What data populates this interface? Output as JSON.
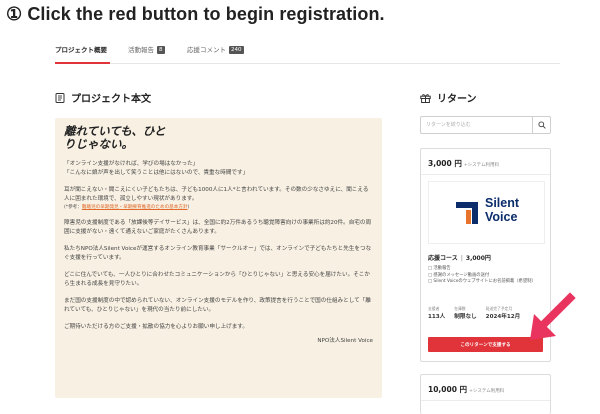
{
  "instruction": "① Click the red button to begin registration.",
  "tabs": [
    {
      "label": "プロジェクト概要"
    },
    {
      "label": "活動報告",
      "badge": "8"
    },
    {
      "label": "応援コメント",
      "badge": "240"
    }
  ],
  "story": {
    "section_title": "プロジェクト本文",
    "heading": "離れていても、ひとりじゃない。",
    "quote1": "「オンライン支援がなければ、学びの場はなかった」",
    "quote2": "「こんなに娘が声を出して笑うことは他にはないので、貴重な時間です」",
    "p1": "耳が聞こえない・聞こえにくい子どもたちは、子ども1000人に1人*と言われています。その数の少なさゆえに、聞こえる人に囲まれた環境で、孤立しやすい現状があります。",
    "note_prefix": "(*参考：",
    "note_link": "難聴児の早期発見・早期療育推進のための基本方針",
    "note_suffix": ")",
    "p2": "障害児の支援制度である「放課後等デイサービス」は、全国に約2万件あるうち聴覚障害向けの事業所は約20件。自宅の周囲に支援がない・遠くて通えないご家庭がたくさんあります。",
    "p3": "私たちNPO法人Silent Voiceが運営するオンライン教育事業「サークルオー」では、オンラインで子どもたちと先生をつなぐ支援を行っています。",
    "p4": "どこに住んでいても、一人ひとりに合わせたコミュニケーションから「ひとりじゃない」と思える安心を届けたい。そこから生まれる成長を見守りたい。",
    "p5": "まだ国の支援制度の中で認められていない、オンライン支援のモデルを作り、政策提言を行うことで国の仕組みとして「離れていても、ひとりじゃない」を現代の当たり前にしたい。",
    "p6": "ご期待いただける方のご支援・拡散の協力を心よりお願い申し上げます。",
    "signature": "NPO法人Silent Voice"
  },
  "returns": {
    "section_title": "リターン",
    "search_placeholder": "リターンを絞り込む",
    "card1": {
      "price": "3,000 円",
      "fee_note": "+システム利用料",
      "logo_line1": "Silent",
      "logo_line2": "Voice",
      "course_name": "応援コース",
      "course_price": "3,000円",
      "features": [
        "□ 活動報告",
        "□ 感謝のメッセージ動画の送付",
        "□ Silent Voiceのウェブサイトにお名前掲載（希望制）"
      ],
      "stats": [
        {
          "label": "支援者",
          "value": "113人"
        },
        {
          "label": "在庫数",
          "value": "制限なし"
        },
        {
          "label": "発送完了予定月",
          "value": "2024年12月"
        }
      ],
      "button_label": "このリターンで支援する"
    },
    "card2": {
      "price": "10,000 円",
      "fee_note": "+システム利用料"
    }
  },
  "colors": {
    "accent_red": "#e0343a",
    "arrow_pink": "#e8345e",
    "logo_navy": "#0b2d6b",
    "logo_orange": "#e8732a",
    "story_bg": "#f7f0e3"
  }
}
